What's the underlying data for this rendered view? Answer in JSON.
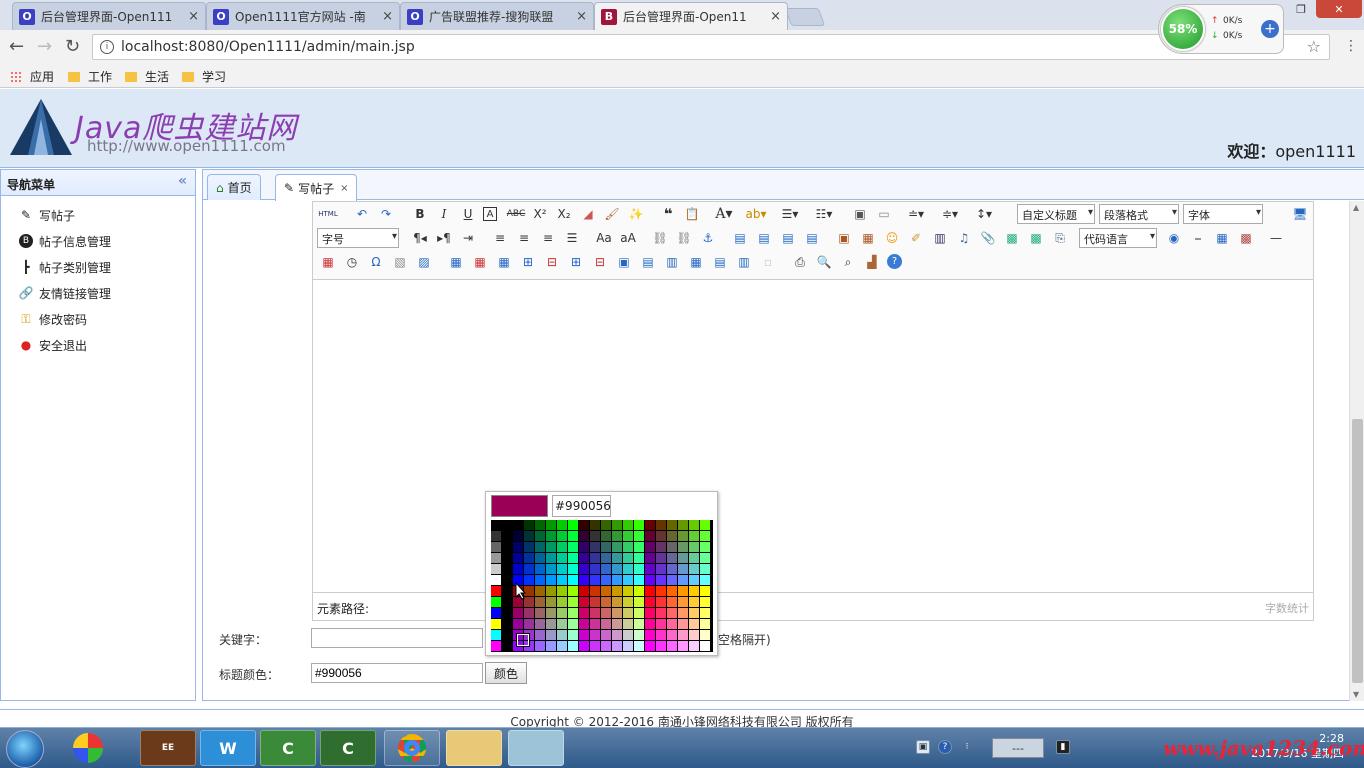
{
  "browser": {
    "tabs": [
      {
        "label": "后台管理界面-Open111",
        "close": "×",
        "fav": "O",
        "fav_color": "#3a3fc4"
      },
      {
        "label": "Open1111官方网站 -南",
        "close": "×",
        "fav": "O",
        "fav_color": "#3a3fc4"
      },
      {
        "label": "广告联盟推荐-搜狗联盟",
        "close": "×",
        "fav": "O",
        "fav_color": "#3a3fc4"
      },
      {
        "label": "后台管理界面-Open11",
        "close": "×",
        "fav": "B",
        "fav_color": "#a0153e"
      }
    ],
    "url": "localhost:8080/Open1111/admin/main.jsp",
    "netmon": {
      "percent": "58%",
      "up": "0K/s",
      "down": "0K/s"
    },
    "bookmarks": [
      "应用",
      "工作",
      "生活",
      "学习"
    ]
  },
  "header": {
    "site_name": "Java爬虫建站网",
    "site_url": "http://www.open1111.com",
    "welcome_label": "欢迎：",
    "username": "open1111"
  },
  "sidebar": {
    "title": "导航菜单",
    "collapse_icon": "«",
    "items": [
      {
        "label": "写帖子",
        "icon": "edit-icon"
      },
      {
        "label": "帖子信息管理",
        "icon": "manage-icon"
      },
      {
        "label": "帖子类别管理",
        "icon": "tree-icon"
      },
      {
        "label": "友情链接管理",
        "icon": "link-icon"
      },
      {
        "label": "修改密码",
        "icon": "key-icon"
      },
      {
        "label": "安全退出",
        "icon": "exit-icon"
      }
    ]
  },
  "page_tabs": [
    {
      "label": "首页",
      "icon": "home-icon"
    },
    {
      "label": "写帖子",
      "icon": "edit-icon",
      "close": "×"
    }
  ],
  "editor": {
    "combos": {
      "custom_title": "自定义标题",
      "paragraph": "段落格式",
      "font": "字体",
      "font_size": "字号",
      "code_lang": "代码语言"
    },
    "element_path": "元素路径:",
    "word_count": "字数统计"
  },
  "form": {
    "keywords_label": "关键字：",
    "keywords_value": "",
    "keywords_hint": "空格隔开)",
    "title_color_label": "标题颜色：",
    "title_color_value": "#990056",
    "color_button": "颜色"
  },
  "color_picker": {
    "selected_hex": "#990056",
    "selected_color": "#990056"
  },
  "footer": {
    "copyright": "Copyright © 2012-2016 南通小锋网络科技有限公司 版权所有"
  },
  "taskbar": {
    "tray_box": "---",
    "time": "2:28",
    "date": "2017/3/16 星期四",
    "watermark": "www.java1234.com"
  }
}
